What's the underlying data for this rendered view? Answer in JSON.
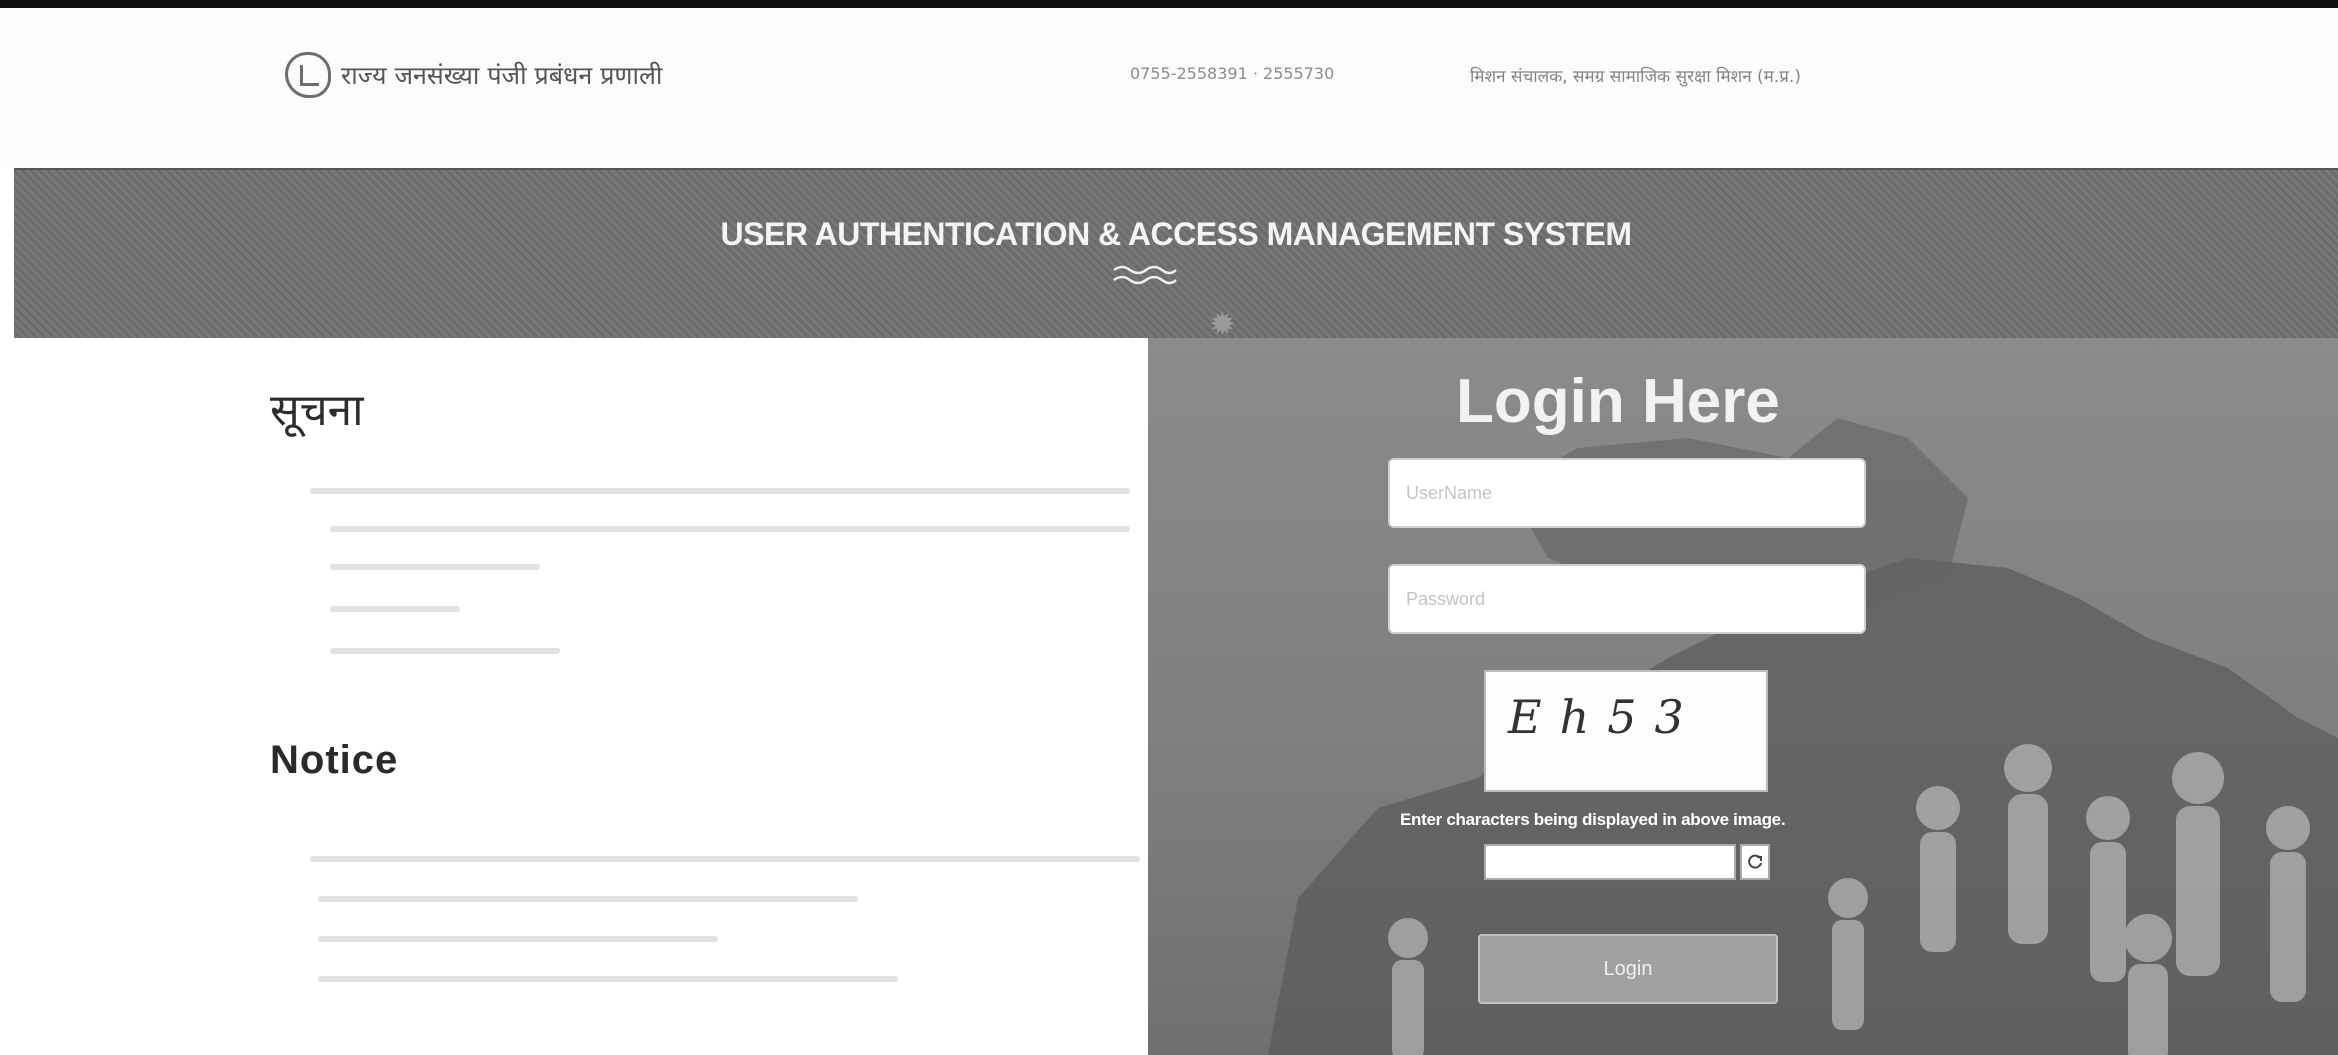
{
  "header": {
    "app_name": "राज्य जनसंख्या पंजी प्रबंधन प्रणाली",
    "phone": "0755-2558391 · 2555730",
    "department": "मिशन संचालक, समग्र सामाजिक सुरक्षा मिशन (म.प्र.)"
  },
  "banner": {
    "title": "USER AUTHENTICATION & ACCESS MANAGEMENT SYSTEM"
  },
  "notice": {
    "hindi_heading": "सूचना",
    "english_heading": "Notice"
  },
  "login": {
    "heading": "Login Here",
    "username_placeholder": "UserName",
    "password_placeholder": "Password",
    "captcha_text": "Eh53",
    "captcha_hint": "Enter characters being displayed in above image.",
    "button_label": "Login"
  },
  "icons": {
    "logo": "emblem-icon",
    "wave": "wave-ornament-icon",
    "sun": "sun-icon",
    "refresh": "refresh-icon"
  }
}
